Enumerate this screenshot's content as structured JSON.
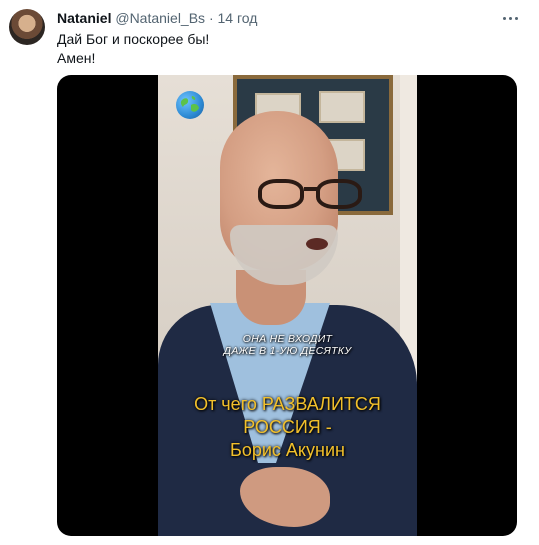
{
  "tweet": {
    "author_name": "Nataniel",
    "author_handle": "@Nataniel_Bs",
    "separator": "·",
    "time": "14 год",
    "text_lines": [
      "Дай Бог и поскорее бы!",
      "Амен!"
    ]
  },
  "video": {
    "overlay_small_lines": [
      "ОНА НЕ ВХОДИТ",
      "ДАЖЕ В 1-УЮ ДЕСЯТКУ"
    ],
    "caption_lines": [
      "От чего РАЗВАЛИТСЯ",
      "РОССИЯ -",
      "Борис Акунин"
    ],
    "caption_color": "#f2c02b"
  },
  "icons": {
    "more": "more-horizontal-icon",
    "globe": "globe-icon"
  }
}
